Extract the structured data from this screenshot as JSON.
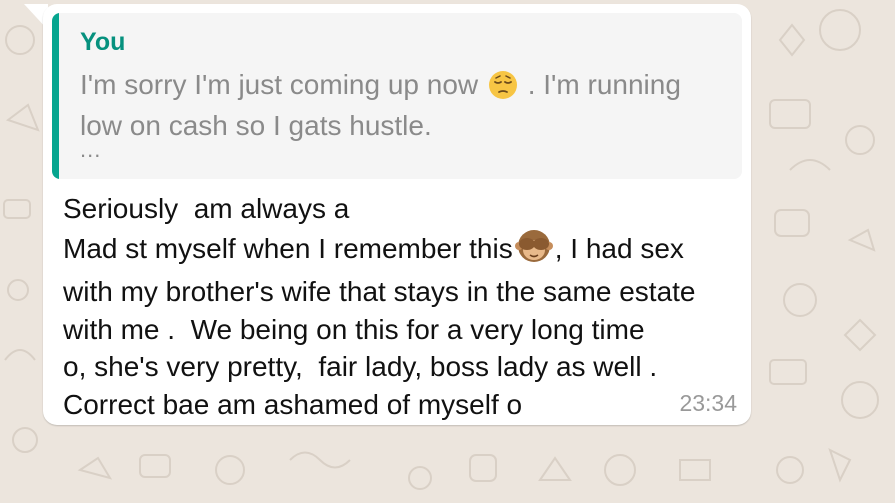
{
  "colors": {
    "wallpaper": "#ece5dd",
    "bubble": "#ffffff",
    "quote_bar": "#06a58f",
    "quote_author": "#06917e",
    "quote_text": "#8a8a8a",
    "message_text": "#111111",
    "timestamp": "#999999"
  },
  "quote": {
    "author": "You",
    "text_before_emoji": "I'm sorry I'm just coming up now",
    "emoji": "pensive-face-emoji",
    "text_after_emoji": ". I'm running low on cash so I gats hustle.",
    "ellipsis": "..."
  },
  "message": {
    "line1": "Seriously  am always a",
    "line2_before_emoji": "Mad st myself when I remember this",
    "emoji": "see-no-evil-monkey-emoji",
    "line2_after_emoji": ", I had sex",
    "line3": "with my brother's wife that stays in the same estate",
    "line4": "with me .  We being on this for a very long time",
    "line5": "o, she's very pretty,  fair lady, boss lady as well .",
    "line6": "Correct bae am ashamed of myself o"
  },
  "timestamp": "23:34"
}
